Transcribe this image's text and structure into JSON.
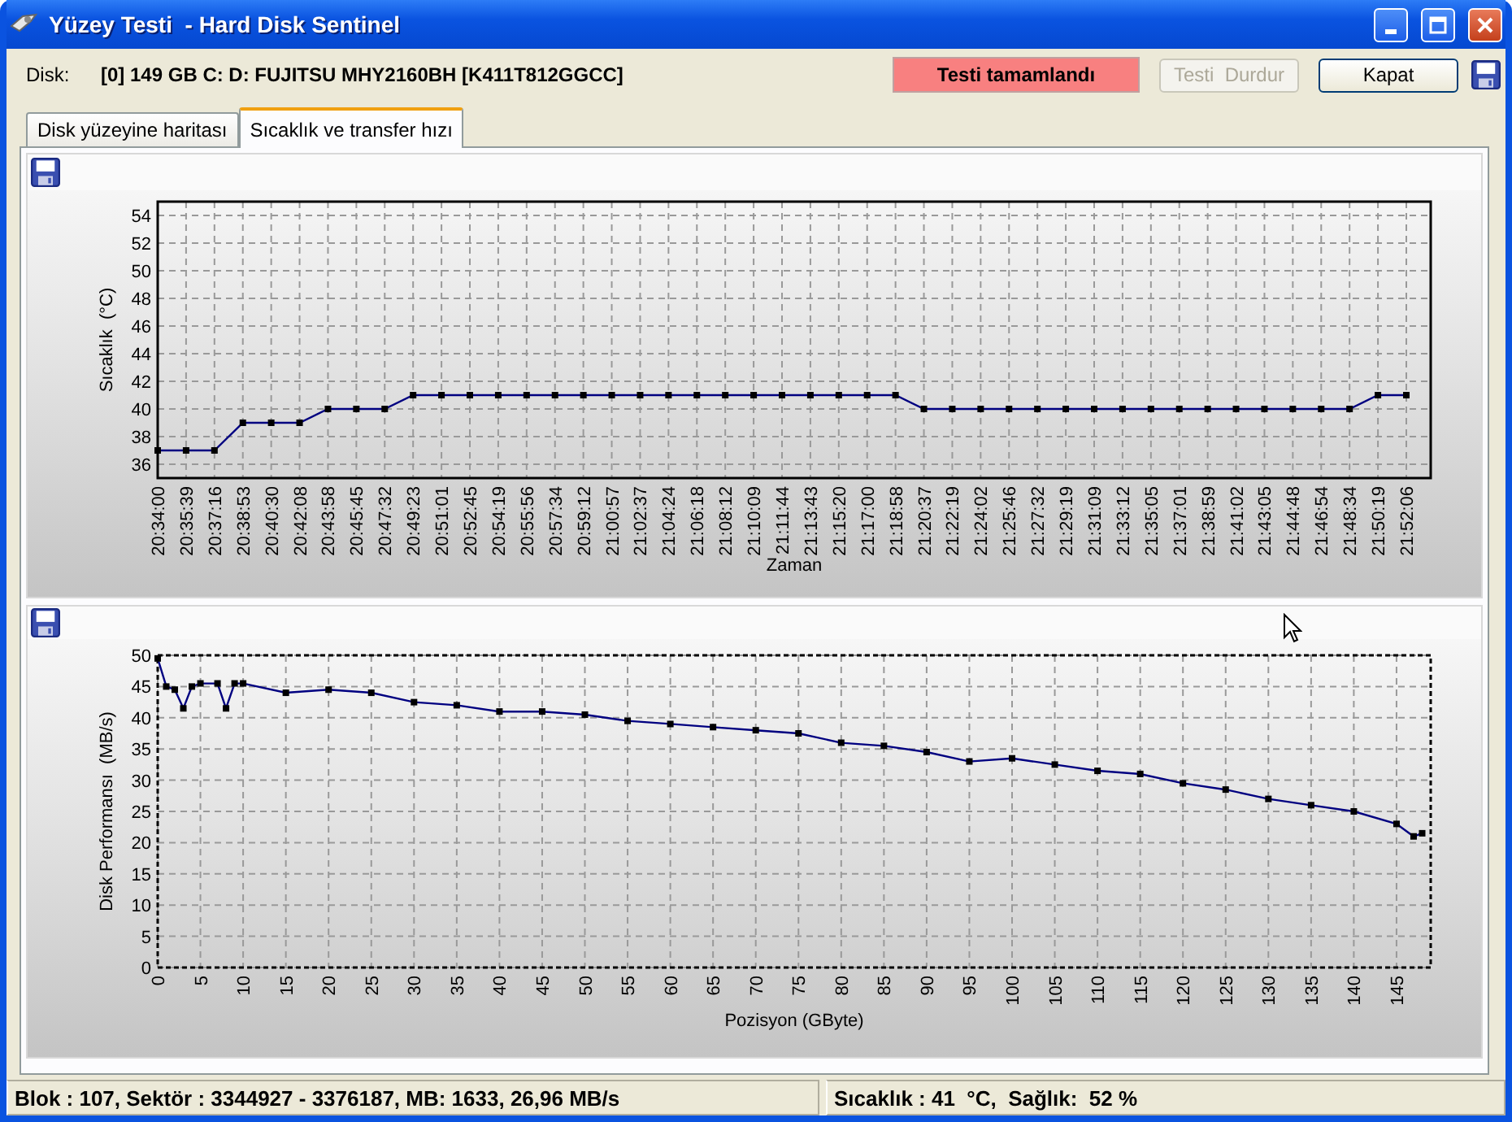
{
  "window": {
    "title": "Yüzey Testi  - Hard Disk Sentinel"
  },
  "header": {
    "disk_label": "Disk:",
    "disk_value": "[0] 149 GB C: D: FUJITSU MHY2160BH [K411T812GGCC]",
    "status": "Testi tamamlandı",
    "buttons": [
      {
        "label": "Testi  Durdur",
        "disabled": true
      },
      {
        "label": "Kapat",
        "disabled": false
      }
    ]
  },
  "tabs": [
    {
      "label": "Disk yüzeyine haritası",
      "selected": false
    },
    {
      "label": "Sıcaklık ve transfer hızı",
      "selected": true
    }
  ],
  "charts": [
    {
      "chart_data": {
        "type": "line",
        "xlabel": "Zaman",
        "ylabel": "Sıcaklık  (°C)",
        "categories": [
          "20:34:00",
          "20:35:39",
          "20:37:16",
          "20:38:53",
          "20:40:30",
          "20:42:08",
          "20:43:58",
          "20:45:45",
          "20:47:32",
          "20:49:23",
          "20:51:01",
          "20:52:45",
          "20:54:19",
          "20:55:56",
          "20:57:34",
          "20:59:12",
          "21:00:57",
          "21:02:37",
          "21:04:24",
          "21:06:18",
          "21:08:12",
          "21:10:09",
          "21:11:44",
          "21:13:43",
          "21:15:20",
          "21:17:00",
          "21:18:58",
          "21:20:37",
          "21:22:19",
          "21:24:02",
          "21:25:46",
          "21:27:32",
          "21:29:19",
          "21:31:09",
          "21:33:12",
          "21:35:05",
          "21:37:01",
          "21:38:59",
          "21:41:02",
          "21:43:05",
          "21:44:48",
          "21:46:54",
          "21:48:34",
          "21:50:19",
          "21:52:06"
        ],
        "series": [
          {
            "color": "#000080",
            "marker": "square",
            "values": [
              37,
              37,
              37,
              39,
              39,
              39,
              40,
              40,
              40,
              41,
              41,
              41,
              41,
              41,
              41,
              41,
              41,
              41,
              41,
              41,
              41,
              41,
              41,
              41,
              41,
              41,
              41,
              40,
              40,
              40,
              40,
              40,
              40,
              40,
              40,
              40,
              40,
              40,
              40,
              40,
              40,
              40,
              40,
              41,
              41
            ]
          }
        ],
        "grid": true,
        "ylim": [
          35,
          55
        ],
        "yticks": [
          36,
          38,
          40,
          42,
          44,
          46,
          48,
          50,
          52,
          54
        ]
      }
    },
    {
      "chart_data": {
        "type": "line",
        "xlabel": "Pozisyon  (GByte)",
        "ylabel": "Disk Performansı  (MB/s)",
        "x": [
          0,
          1,
          2,
          3,
          4,
          5,
          7,
          8,
          9,
          10,
          15,
          20,
          25,
          30,
          35,
          40,
          45,
          50,
          55,
          60,
          65,
          70,
          75,
          80,
          85,
          90,
          95,
          100,
          105,
          110,
          115,
          120,
          125,
          130,
          135,
          140,
          145,
          147,
          148
        ],
        "series": [
          {
            "color": "#000080",
            "marker": "square",
            "values": [
              49.5,
              45,
              44.5,
              41.5,
              45,
              45.5,
              45.5,
              41.5,
              45.5,
              45.5,
              44,
              44.5,
              44,
              42.5,
              42,
              41,
              41,
              40.5,
              39.5,
              39,
              38.5,
              38,
              37.5,
              36,
              35.5,
              34.5,
              33,
              33.5,
              32.5,
              31.5,
              31,
              29.5,
              28.5,
              27,
              26,
              25,
              23,
              21,
              21.5
            ]
          }
        ],
        "grid": true,
        "xlim": [
          0,
          149
        ],
        "ylim": [
          0,
          50
        ],
        "xticks": [
          0,
          5,
          10,
          15,
          20,
          25,
          30,
          35,
          40,
          45,
          50,
          55,
          60,
          65,
          70,
          75,
          80,
          85,
          90,
          95,
          100,
          105,
          110,
          115,
          120,
          125,
          130,
          135,
          140,
          145
        ],
        "yticks": [
          0,
          5,
          10,
          15,
          20,
          25,
          30,
          35,
          40,
          45,
          50
        ]
      }
    }
  ],
  "status_bar": [
    "Blok : 107, Sektör : 3344927 - 3376187, MB: 1633, 26,96 MB/s",
    "Sıcaklık : 41  °C,  Sağlık:  52 %"
  ]
}
